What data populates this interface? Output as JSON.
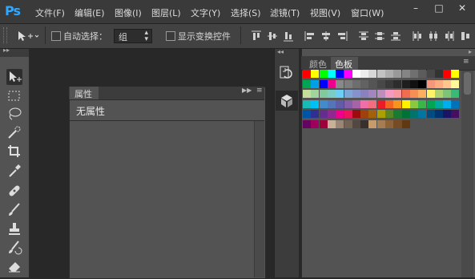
{
  "app": {
    "logo": "Ps"
  },
  "menubar": {
    "items": [
      "文件(F)",
      "编辑(E)",
      "图像(I)",
      "图层(L)",
      "文字(Y)",
      "选择(S)",
      "滤镜(T)",
      "视图(V)",
      "窗口(W)"
    ],
    "window_controls": [
      "–",
      "□",
      "✕"
    ]
  },
  "options": {
    "auto_select_label": "自动选择：",
    "auto_select_value": "组",
    "show_transform_label": "显示变换控件"
  },
  "properties_panel": {
    "tab": "属性",
    "empty_text": "无属性"
  },
  "swatches_panel": {
    "tabs": [
      "颜色",
      "色板"
    ],
    "swatch_rows": [
      [
        "#ff0000",
        "#ffff00",
        "#00ff00",
        "#00ffff",
        "#0000ff",
        "#ff00ff",
        "#ffffff",
        "#ebebeb",
        "#d6d6d6",
        "#c2c2c2",
        "#adadad",
        "#999999",
        "#858585",
        "#707070",
        "#5c5c5c",
        "#474747",
        "#333333",
        "#ff0000",
        "#ffff00"
      ],
      [
        "#00a651",
        "#00a0e9",
        "#0000ff",
        "#ec008c",
        "#898989",
        "#7d7d7d",
        "#6e6e6e",
        "#626262",
        "#555555",
        "#484848",
        "#3a3a3a",
        "#2d2d2d",
        "#1e1e1e",
        "#111111",
        "#000000",
        "#f7977a",
        "#fbad82",
        "#fdc68a",
        "#fff79a"
      ],
      [
        "#c4df9b",
        "#a2d39c",
        "#82ca9d",
        "#7bcdc8",
        "#6ecff6",
        "#7ea7d8",
        "#8493ca",
        "#8882be",
        "#a187be",
        "#bc8dbf",
        "#f49ac2",
        "#f6989d",
        "#f26c4f",
        "#f68e55",
        "#fbaf5c",
        "#fff467",
        "#acd372",
        "#7cc576",
        "#3bb878"
      ],
      [
        "#1abbb4",
        "#00bff3",
        "#438ccb",
        "#5574b9",
        "#605ca8",
        "#855fa8",
        "#a763a8",
        "#f06ea9",
        "#f26d7d",
        "#ed1c24",
        "#f26522",
        "#f7941d",
        "#fff200",
        "#8dc73f",
        "#39b54a",
        "#00a651",
        "#00a99d",
        "#00aeef",
        "#0072bc"
      ],
      [
        "#0054a6",
        "#2e3192",
        "#662d91",
        "#92278f",
        "#ec008c",
        "#ed145b",
        "#9e0b0f",
        "#a0410d",
        "#a36209",
        "#aba000",
        "#598527",
        "#197b30",
        "#007236",
        "#00746b",
        "#0076a3",
        "#004b80",
        "#003471",
        "#1b1464",
        "#440e62"
      ],
      [
        "#630460",
        "#9e005d",
        "#9e0039",
        "#c7b299",
        "#998675",
        "#736357",
        "#534741",
        "#37302d",
        "#c69c6d",
        "#a67c52",
        "#8c6239",
        "#754c24",
        "#603913"
      ]
    ]
  }
}
